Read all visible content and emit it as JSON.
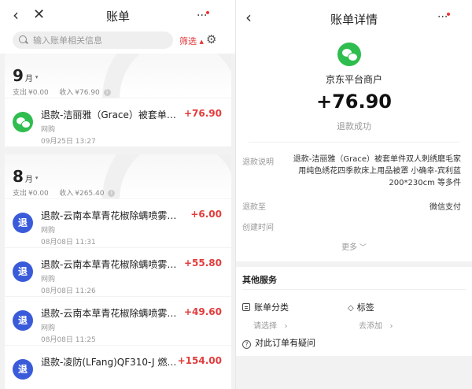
{
  "left": {
    "header": {
      "back_icon": "‹",
      "close_icon": "✕",
      "title": "账单",
      "more_icon": "···"
    },
    "search": {
      "placeholder": "输入账单相关信息",
      "filter_label": "筛选",
      "filter_caret": "▲",
      "settings_icon": "⚙"
    },
    "months": [
      {
        "month_num": "9",
        "month_unit": "月",
        "caret": "▾",
        "expense_label": "支出",
        "expense_value": "¥0.00",
        "income_label": "收入",
        "income_value": "¥76.90",
        "info_icon": "i",
        "transactions": [
          {
            "icon": "wechat-pay-icon",
            "name": "退款-洁丽雅（Grace）被套单件...",
            "amount": "+76.90",
            "source": "网购",
            "time": "09月25日 13:27"
          }
        ]
      },
      {
        "month_num": "8",
        "month_unit": "月",
        "caret": "▾",
        "expense_label": "支出",
        "expense_value": "¥0.00",
        "income_label": "收入",
        "income_value": "¥265.40",
        "info_icon": "i",
        "transactions": [
          {
            "icon_text": "退",
            "name": "退款-云南本草青花椒除螨喷雾去螨...",
            "amount": "+6.00",
            "source": "网购",
            "time": "08月08日 11:31"
          },
          {
            "icon_text": "退",
            "name": "退款-云南本草青花椒除螨喷雾去...",
            "amount": "+55.80",
            "source": "网购",
            "time": "08月08日 11:26"
          },
          {
            "icon_text": "退",
            "name": "退款-云南本草青花椒除螨喷雾去...",
            "amount": "+49.60",
            "source": "网购",
            "time": "08月08日 11:25"
          },
          {
            "icon_text": "退",
            "name": "退款-凌防(LFang)QF310-J 燃气...",
            "amount": "+154.00",
            "source": "",
            "time": ""
          }
        ]
      }
    ]
  },
  "right": {
    "header": {
      "back_icon": "‹",
      "title": "账单详情",
      "more_icon": "···"
    },
    "merchant": {
      "logo_icon": "wechat-icon",
      "name": "京东平台商户"
    },
    "amount": "+76.90",
    "status": "退款成功",
    "details": {
      "desc_label": "退款说明",
      "desc_value": "退款-洁丽雅（Grace）被套单件双人刺绣磨毛家用纯色绣花四季款床上用品被罩 小确幸-宾利蓝 200*230cm 等多件",
      "to_label": "退款至",
      "to_value": "微信支付",
      "created_label": "创建时间",
      "more_label": "更多"
    },
    "services": {
      "title": "其他服务",
      "category_label": "账单分类",
      "category_action": "请选择",
      "tag_label": "标签",
      "tag_action": "去添加",
      "question_label": "对此订单有疑问",
      "question_icon": "?",
      "tag_icon": "◇",
      "chevron": "›"
    }
  }
}
